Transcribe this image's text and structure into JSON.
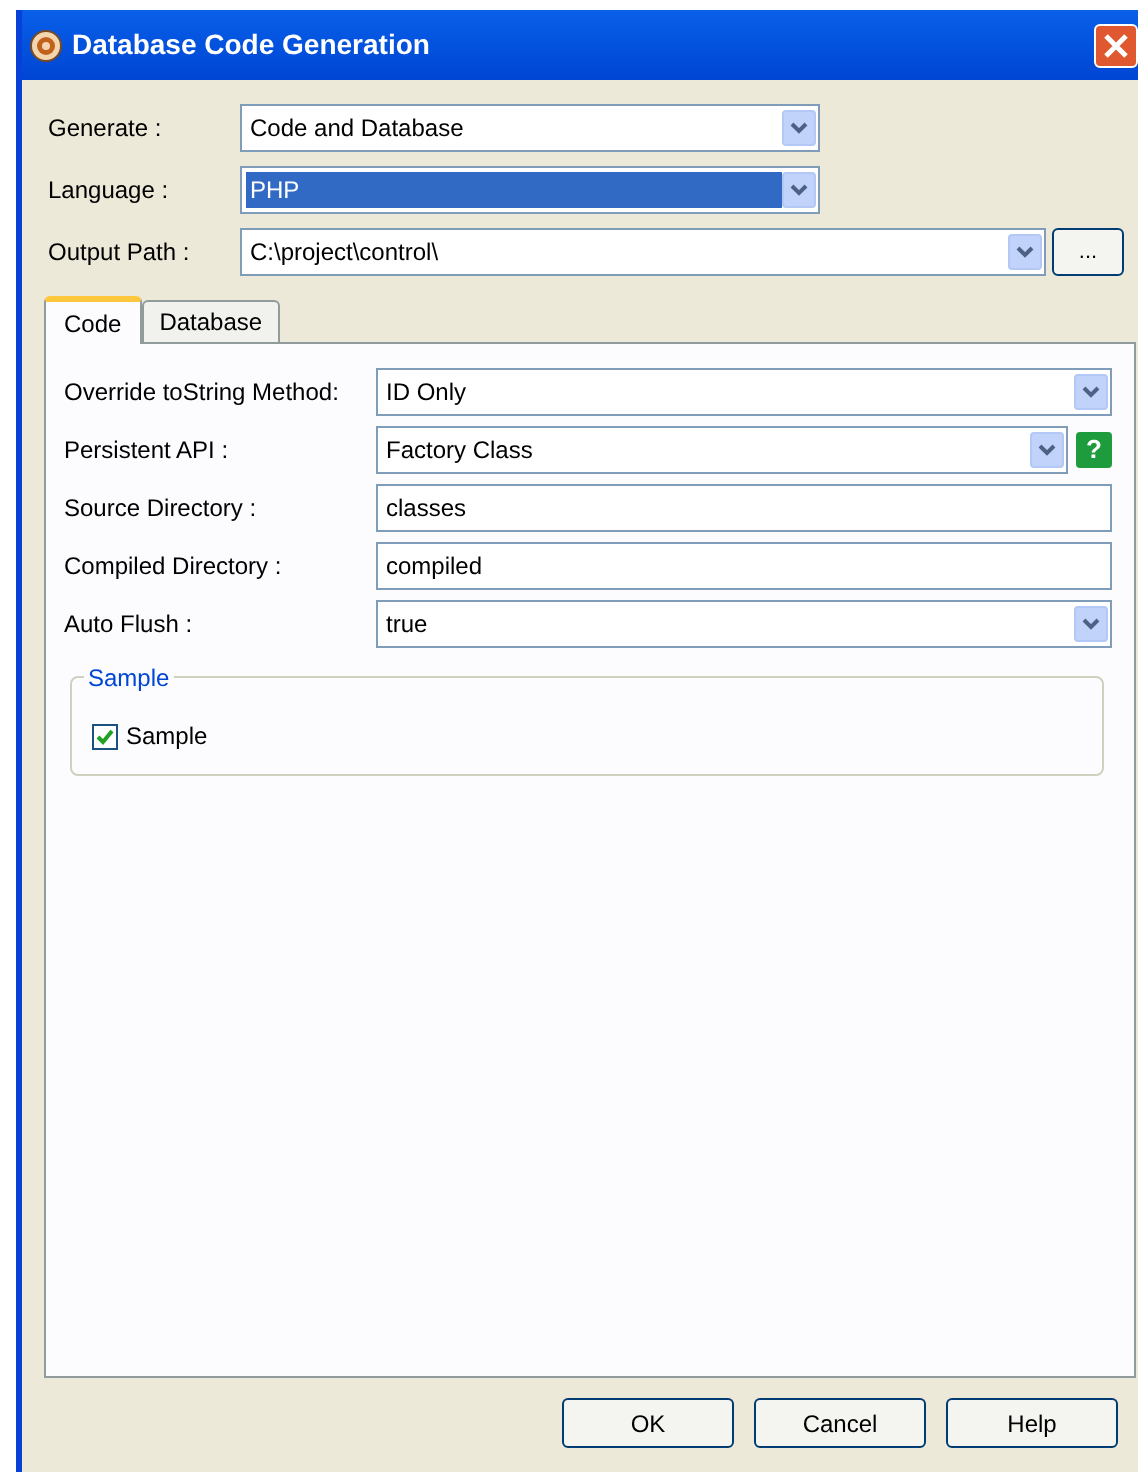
{
  "window": {
    "title": "Database Code Generation"
  },
  "top_fields": [
    {
      "label": "Generate :",
      "kind": "combo",
      "value": "Code and Database",
      "highlighted": false
    },
    {
      "label": "Language :",
      "kind": "combo",
      "value": "PHP",
      "highlighted": true
    },
    {
      "label": "Output Path :",
      "kind": "combo",
      "value": "C:\\project\\control\\",
      "highlighted": false,
      "button": "..."
    }
  ],
  "tabs": [
    {
      "label": "Code",
      "selected": true
    },
    {
      "label": "Database",
      "selected": false
    }
  ],
  "code_fields": [
    {
      "label": "Override toString Method:",
      "kind": "combo",
      "value": "ID Only"
    },
    {
      "label": "Persistent API :",
      "kind": "combo",
      "value": "Factory Class",
      "help": "?"
    },
    {
      "label": "Source Directory :",
      "kind": "text",
      "value": "classes"
    },
    {
      "label": "Compiled Directory :",
      "kind": "text",
      "value": "compiled"
    },
    {
      "label": "Auto Flush :",
      "kind": "combo",
      "value": "true"
    }
  ],
  "group": {
    "title": "Sample",
    "checkbox": {
      "label": "Sample",
      "checked": true
    }
  },
  "buttons": [
    "OK",
    "Cancel",
    "Help"
  ]
}
